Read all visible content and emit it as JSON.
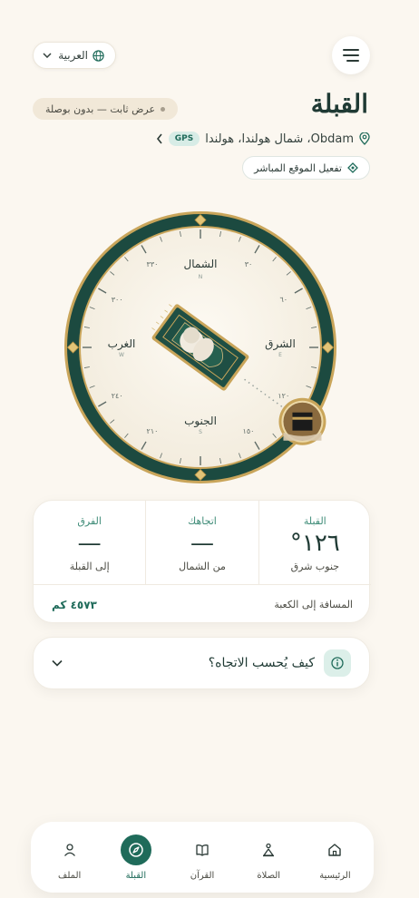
{
  "header": {
    "title": "القبلة",
    "language_label": "العربية",
    "static_badge": "عرض ثابت — بدون بوصلة",
    "location_text": "Obdam، شمال هولندا، هولندا",
    "gps_badge": "GPS",
    "live_location_button": "تفعيل الموقع المباشر"
  },
  "compass": {
    "north": "الشمال",
    "north_abbr": "N",
    "east": "الشرق",
    "east_abbr": "E",
    "south": "الجنوب",
    "south_abbr": "S",
    "west": "الغرب",
    "west_abbr": "W",
    "degree_labels": [
      {
        "deg": 30,
        "label": "٣٠"
      },
      {
        "deg": 60,
        "label": "٦٠"
      },
      {
        "deg": 120,
        "label": "١٢٠"
      },
      {
        "deg": 150,
        "label": "١٥٠"
      },
      {
        "deg": 210,
        "label": "٢١٠"
      },
      {
        "deg": 240,
        "label": "٢٤٠"
      },
      {
        "deg": 300,
        "label": "٣٠٠"
      },
      {
        "deg": 330,
        "label": "٣٣٠"
      }
    ],
    "qibla_bearing_deg": 126
  },
  "stats": {
    "qibla": {
      "label": "القبلة",
      "value": "١٢٦°",
      "sub": "جنوب شرق"
    },
    "heading": {
      "label": "اتجاهك",
      "value": "—",
      "sub": "من الشمال"
    },
    "difference": {
      "label": "الفرق",
      "value": "—",
      "sub": "إلى القبلة"
    },
    "distance_label": "المسافة إلى الكعبة",
    "distance_value": "٤٥٧٣ كم"
  },
  "how": {
    "title": "كيف يُحسب الاتجاه؟"
  },
  "nav": {
    "items": [
      {
        "label": "الرئيسية",
        "icon": "home-icon"
      },
      {
        "label": "الصلاة",
        "icon": "prayer-icon"
      },
      {
        "label": "القرآن",
        "icon": "book-icon"
      },
      {
        "label": "القبلة",
        "icon": "compass-icon",
        "active": true
      },
      {
        "label": "الملف",
        "icon": "user-icon"
      }
    ]
  },
  "colors": {
    "primary": "#1f6b5a",
    "ring": "#1c4a40",
    "gold": "#c9a55a",
    "background": "#fbf7f0"
  }
}
